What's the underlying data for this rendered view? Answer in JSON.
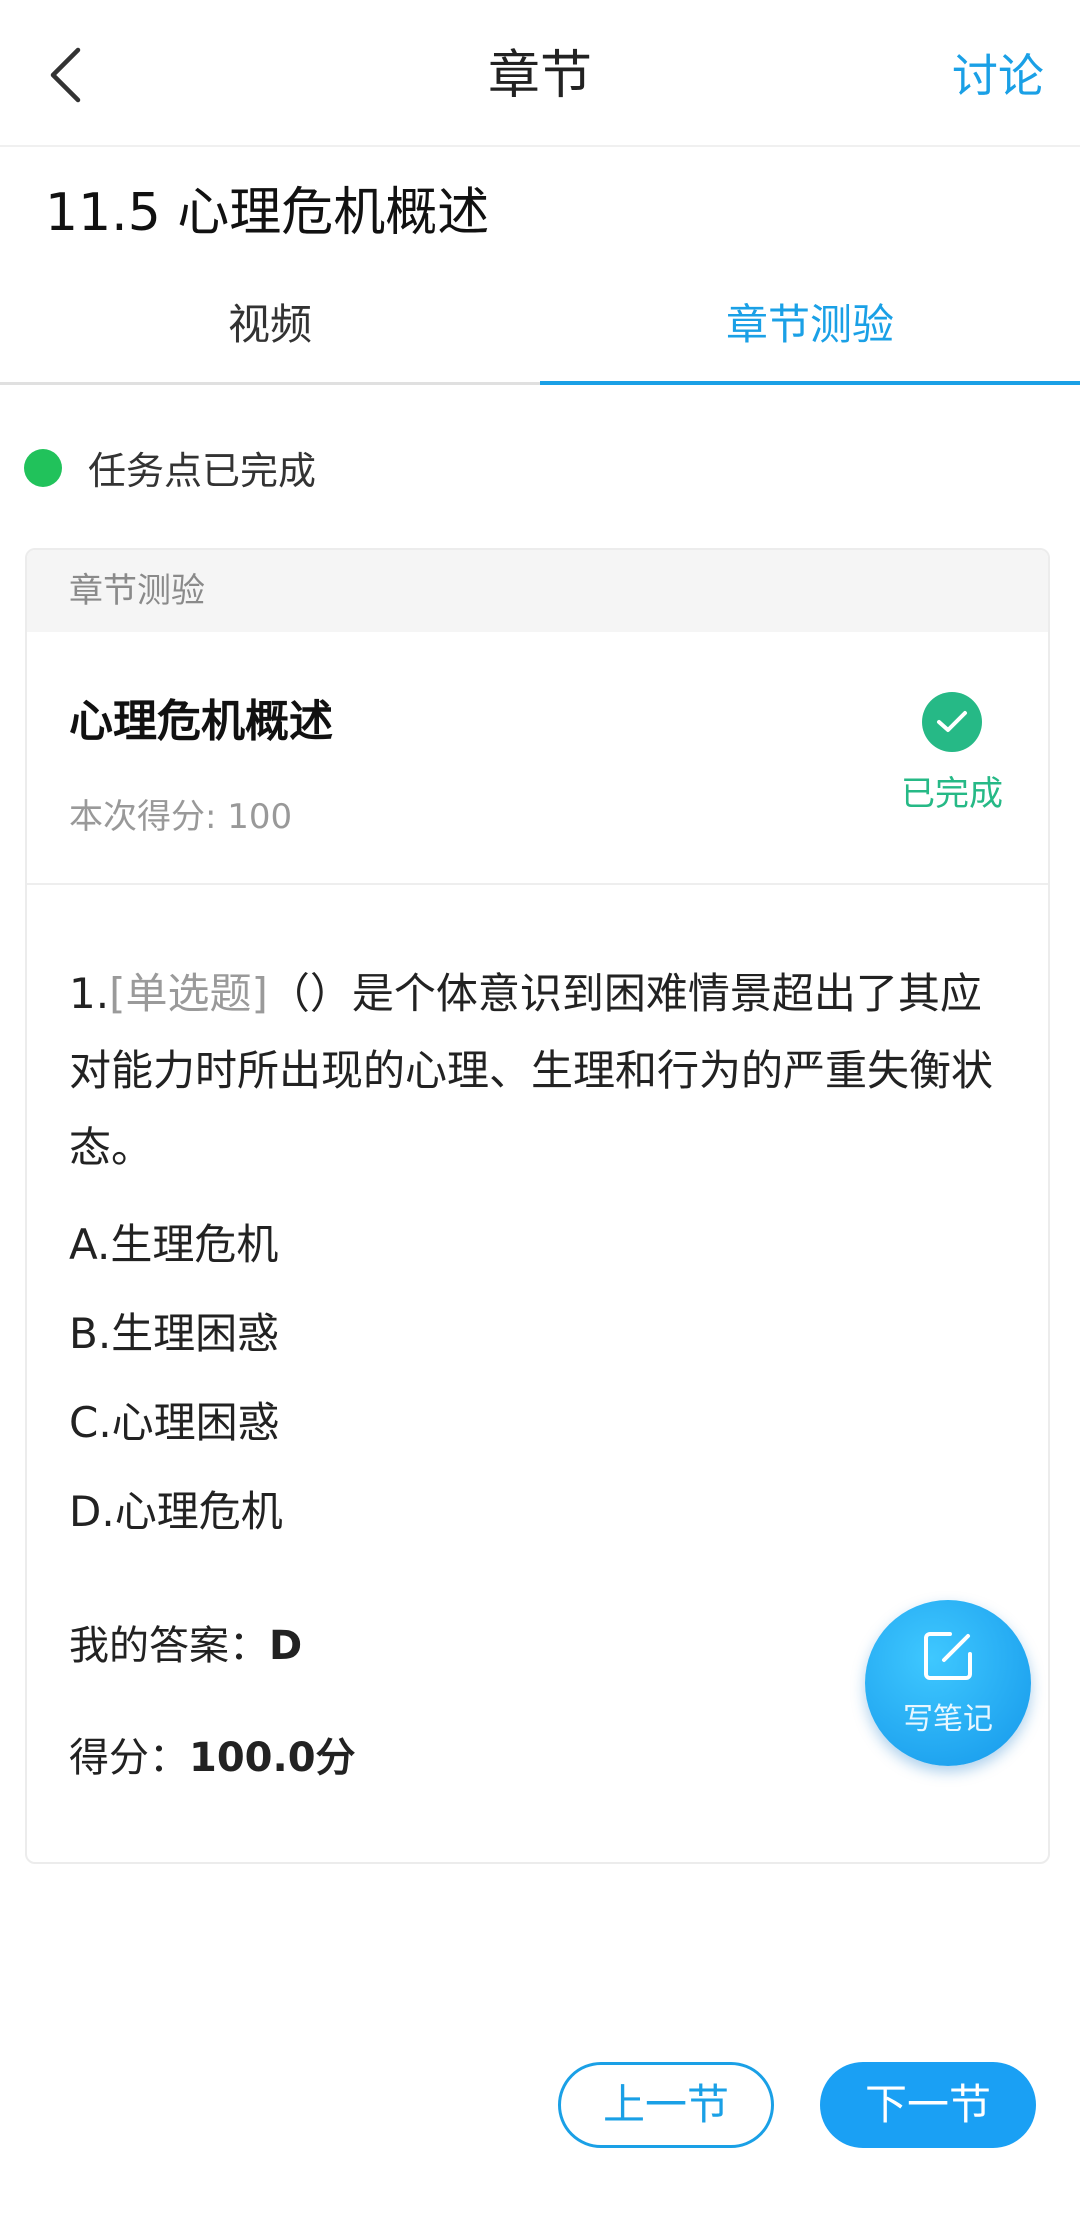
{
  "header": {
    "title": "章节",
    "discuss_label": "讨论"
  },
  "section": {
    "title": "11.5 心理危机概述"
  },
  "tabs": [
    {
      "label": "视频",
      "active": false
    },
    {
      "label": "章节测验",
      "active": true
    }
  ],
  "task_status": {
    "text": "任务点已完成",
    "color": "#21c25b"
  },
  "card": {
    "header": "章节测验",
    "quiz_title": "心理危机概述",
    "score_text": "本次得分: 100",
    "status_label": "已完成",
    "question": {
      "number": "1.",
      "type": "[单选题]",
      "text": "（）是个体意识到困难情景超出了其应对能力时所出现的心理、生理和行为的严重失衡状态。",
      "options": [
        "A.生理危机",
        "B.生理困惑",
        "C.心理困惑",
        "D.心理危机"
      ],
      "my_answer_label": "我的答案：",
      "my_answer_value": "D",
      "score_label": "得分：",
      "score_value": "100.0分"
    }
  },
  "fab": {
    "label": "写笔记",
    "icon": "edit-note-icon"
  },
  "nav": {
    "prev_label": "上一节",
    "next_label": "下一节"
  },
  "colors": {
    "accent": "#1aa0e6",
    "success": "#26b986"
  }
}
